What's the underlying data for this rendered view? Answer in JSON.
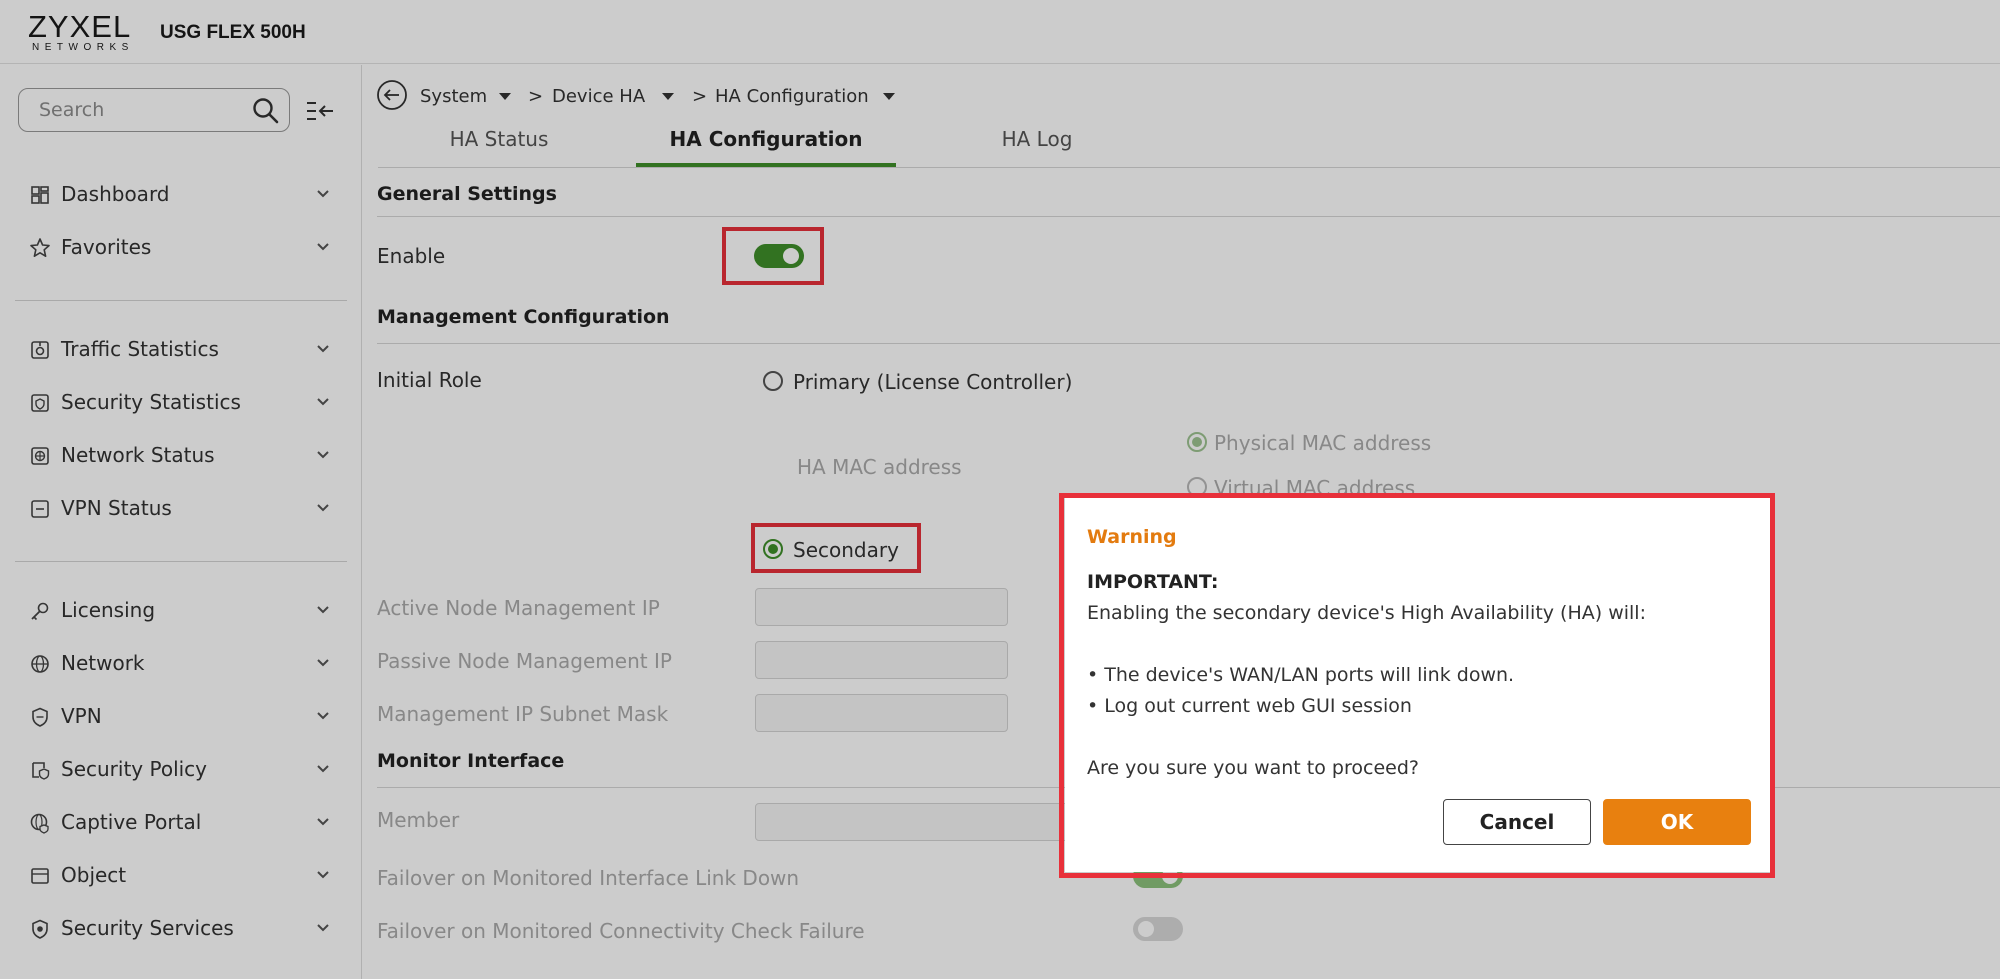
{
  "header": {
    "logo_main": "ZYXEL",
    "logo_sub": "NETWORKS",
    "model": "USG FLEX 500H"
  },
  "sidebar": {
    "search_placeholder": "Search",
    "items": [
      {
        "label": "Dashboard",
        "icon": "dashboard-icon"
      },
      {
        "label": "Favorites",
        "icon": "star-icon"
      },
      {
        "label": "Traffic Statistics",
        "icon": "traffic-statistics-icon"
      },
      {
        "label": "Security Statistics",
        "icon": "security-statistics-icon"
      },
      {
        "label": "Network Status",
        "icon": "network-status-icon"
      },
      {
        "label": "VPN Status",
        "icon": "vpn-status-icon"
      },
      {
        "label": "Licensing",
        "icon": "key-icon"
      },
      {
        "label": "Network",
        "icon": "globe-icon"
      },
      {
        "label": "VPN",
        "icon": "shield-icon"
      },
      {
        "label": "Security Policy",
        "icon": "security-policy-icon"
      },
      {
        "label": "Captive Portal",
        "icon": "captive-portal-icon"
      },
      {
        "label": "Object",
        "icon": "object-icon"
      },
      {
        "label": "Security Services",
        "icon": "security-services-icon"
      }
    ]
  },
  "breadcrumb": {
    "items": [
      "System",
      "Device HA",
      "HA Configuration"
    ],
    "separator": ">"
  },
  "tabs": [
    {
      "label": "HA Status",
      "active": false
    },
    {
      "label": "HA Configuration",
      "active": true
    },
    {
      "label": "HA Log",
      "active": false
    }
  ],
  "general": {
    "title": "General Settings",
    "enable_label": "Enable",
    "enable_on": true
  },
  "management": {
    "title": "Management Configuration",
    "initial_role_label": "Initial Role",
    "primary_label": "Primary (License Controller)",
    "ha_mac_label": "HA MAC address",
    "physical_mac_label": "Physical MAC address",
    "virtual_mac_label": "Virtual MAC address",
    "secondary_label": "Secondary",
    "selected_role": "Secondary",
    "active_ip_label": "Active Node Management IP",
    "passive_ip_label": "Passive Node Management IP",
    "subnet_label": "Management IP Subnet Mask"
  },
  "monitor": {
    "title": "Monitor Interface",
    "member_label": "Member",
    "failover_link_label": "Failover on Monitored Interface Link Down",
    "failover_conn_label": "Failover on Monitored Connectivity Check Failure"
  },
  "dialog": {
    "title": "Warning",
    "important": "IMPORTANT:",
    "line1": "Enabling the secondary device's High Availability (HA) will:",
    "bullet1": "• The device's WAN/LAN ports will link down.",
    "bullet2": "• Log out current web GUI session",
    "question": "Are you sure you want to proceed?",
    "cancel_label": "Cancel",
    "ok_label": "OK"
  },
  "colors": {
    "accent_green": "#3f8f2a",
    "warning_orange": "#e37b0f",
    "ok_button": "#e8800f",
    "highlight_red": "#e8303a"
  }
}
